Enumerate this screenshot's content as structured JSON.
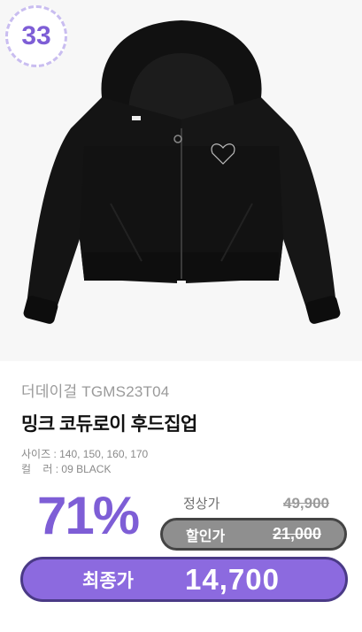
{
  "rank": {
    "number": "33"
  },
  "product": {
    "brand": "더데이걸 TGMS23T04",
    "name": "밍크 코듀로이 후드집업",
    "size_line": "사이즈 : 140, 150, 160, 170",
    "color_line": "컬    러 : 09 BLACK",
    "image_icon": "black-hoodie-jacket"
  },
  "pricing": {
    "discount_rate": "71%",
    "normal_label": "정상가",
    "normal_price": "49,900",
    "sale_label": "할인가",
    "sale_price": "21,000",
    "final_label": "최종가",
    "final_price": "14,700"
  },
  "colors": {
    "accent": "#7e5ed6",
    "final_bg": "#8c6adf",
    "sale_bg": "#8f8f8f",
    "badge_border": "#c9bdf0"
  }
}
